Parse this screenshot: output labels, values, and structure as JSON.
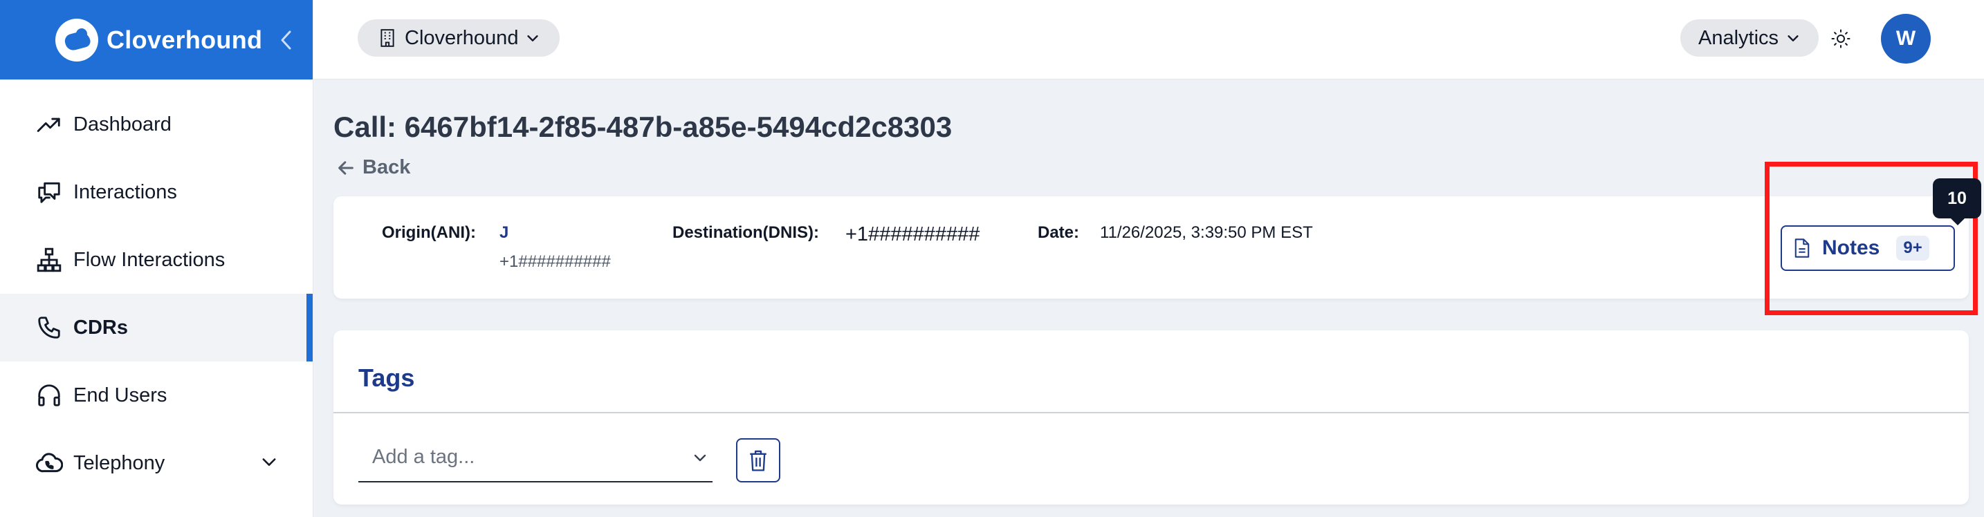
{
  "brand": {
    "name": "Cloverhound"
  },
  "sidebar": {
    "items": [
      {
        "label": "Dashboard",
        "icon": "trend-up-icon"
      },
      {
        "label": "Interactions",
        "icon": "chat-bubbles-icon"
      },
      {
        "label": "Flow Interactions",
        "icon": "flow-tree-icon"
      },
      {
        "label": "CDRs",
        "icon": "phone-icon",
        "active": true
      },
      {
        "label": "End Users",
        "icon": "headset-icon"
      },
      {
        "label": "Telephony",
        "icon": "cloud-phone-icon",
        "expandable": true
      }
    ]
  },
  "topbar": {
    "org": "Cloverhound",
    "analytics": "Analytics",
    "avatar_initial": "W"
  },
  "page": {
    "title": "Call: 6467bf14-2f85-487b-a85e-5494cd2c8303",
    "back": "Back"
  },
  "call": {
    "origin_label": "Origin(ANI):",
    "origin_name": "J",
    "origin_number": "+1##########",
    "destination_label": "Destination(DNIS):",
    "destination_value": "+1##########",
    "date_label": "Date:",
    "date_value": "11/26/2025, 3:39:50 PM EST"
  },
  "notes": {
    "label": "Notes",
    "badge": "9+",
    "tooltip": "10"
  },
  "tags": {
    "title": "Tags",
    "placeholder": "Add a tag..."
  },
  "colors": {
    "brand": "#1f6fd6",
    "accent_navy": "#1e3a8a",
    "highlight": "#ff1a1a",
    "background": "#eef2f6"
  }
}
